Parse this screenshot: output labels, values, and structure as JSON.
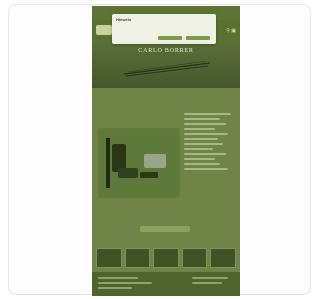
{
  "cookie_banner": {
    "title": "Hinweis",
    "text": "",
    "accept_label": "",
    "settings_label": ""
  },
  "header": {
    "logo_text": "",
    "icons": [
      "search-icon",
      "cart-icon"
    ]
  },
  "banner": {
    "title": "CARLO BORRER",
    "subtitle": ""
  },
  "main": {
    "section_title": "",
    "cta_label": "",
    "thumbs_title": ""
  },
  "colors": {
    "page_green": "#6f8446",
    "header_green": "#5a7131",
    "accent_green": "#8aa35b"
  }
}
